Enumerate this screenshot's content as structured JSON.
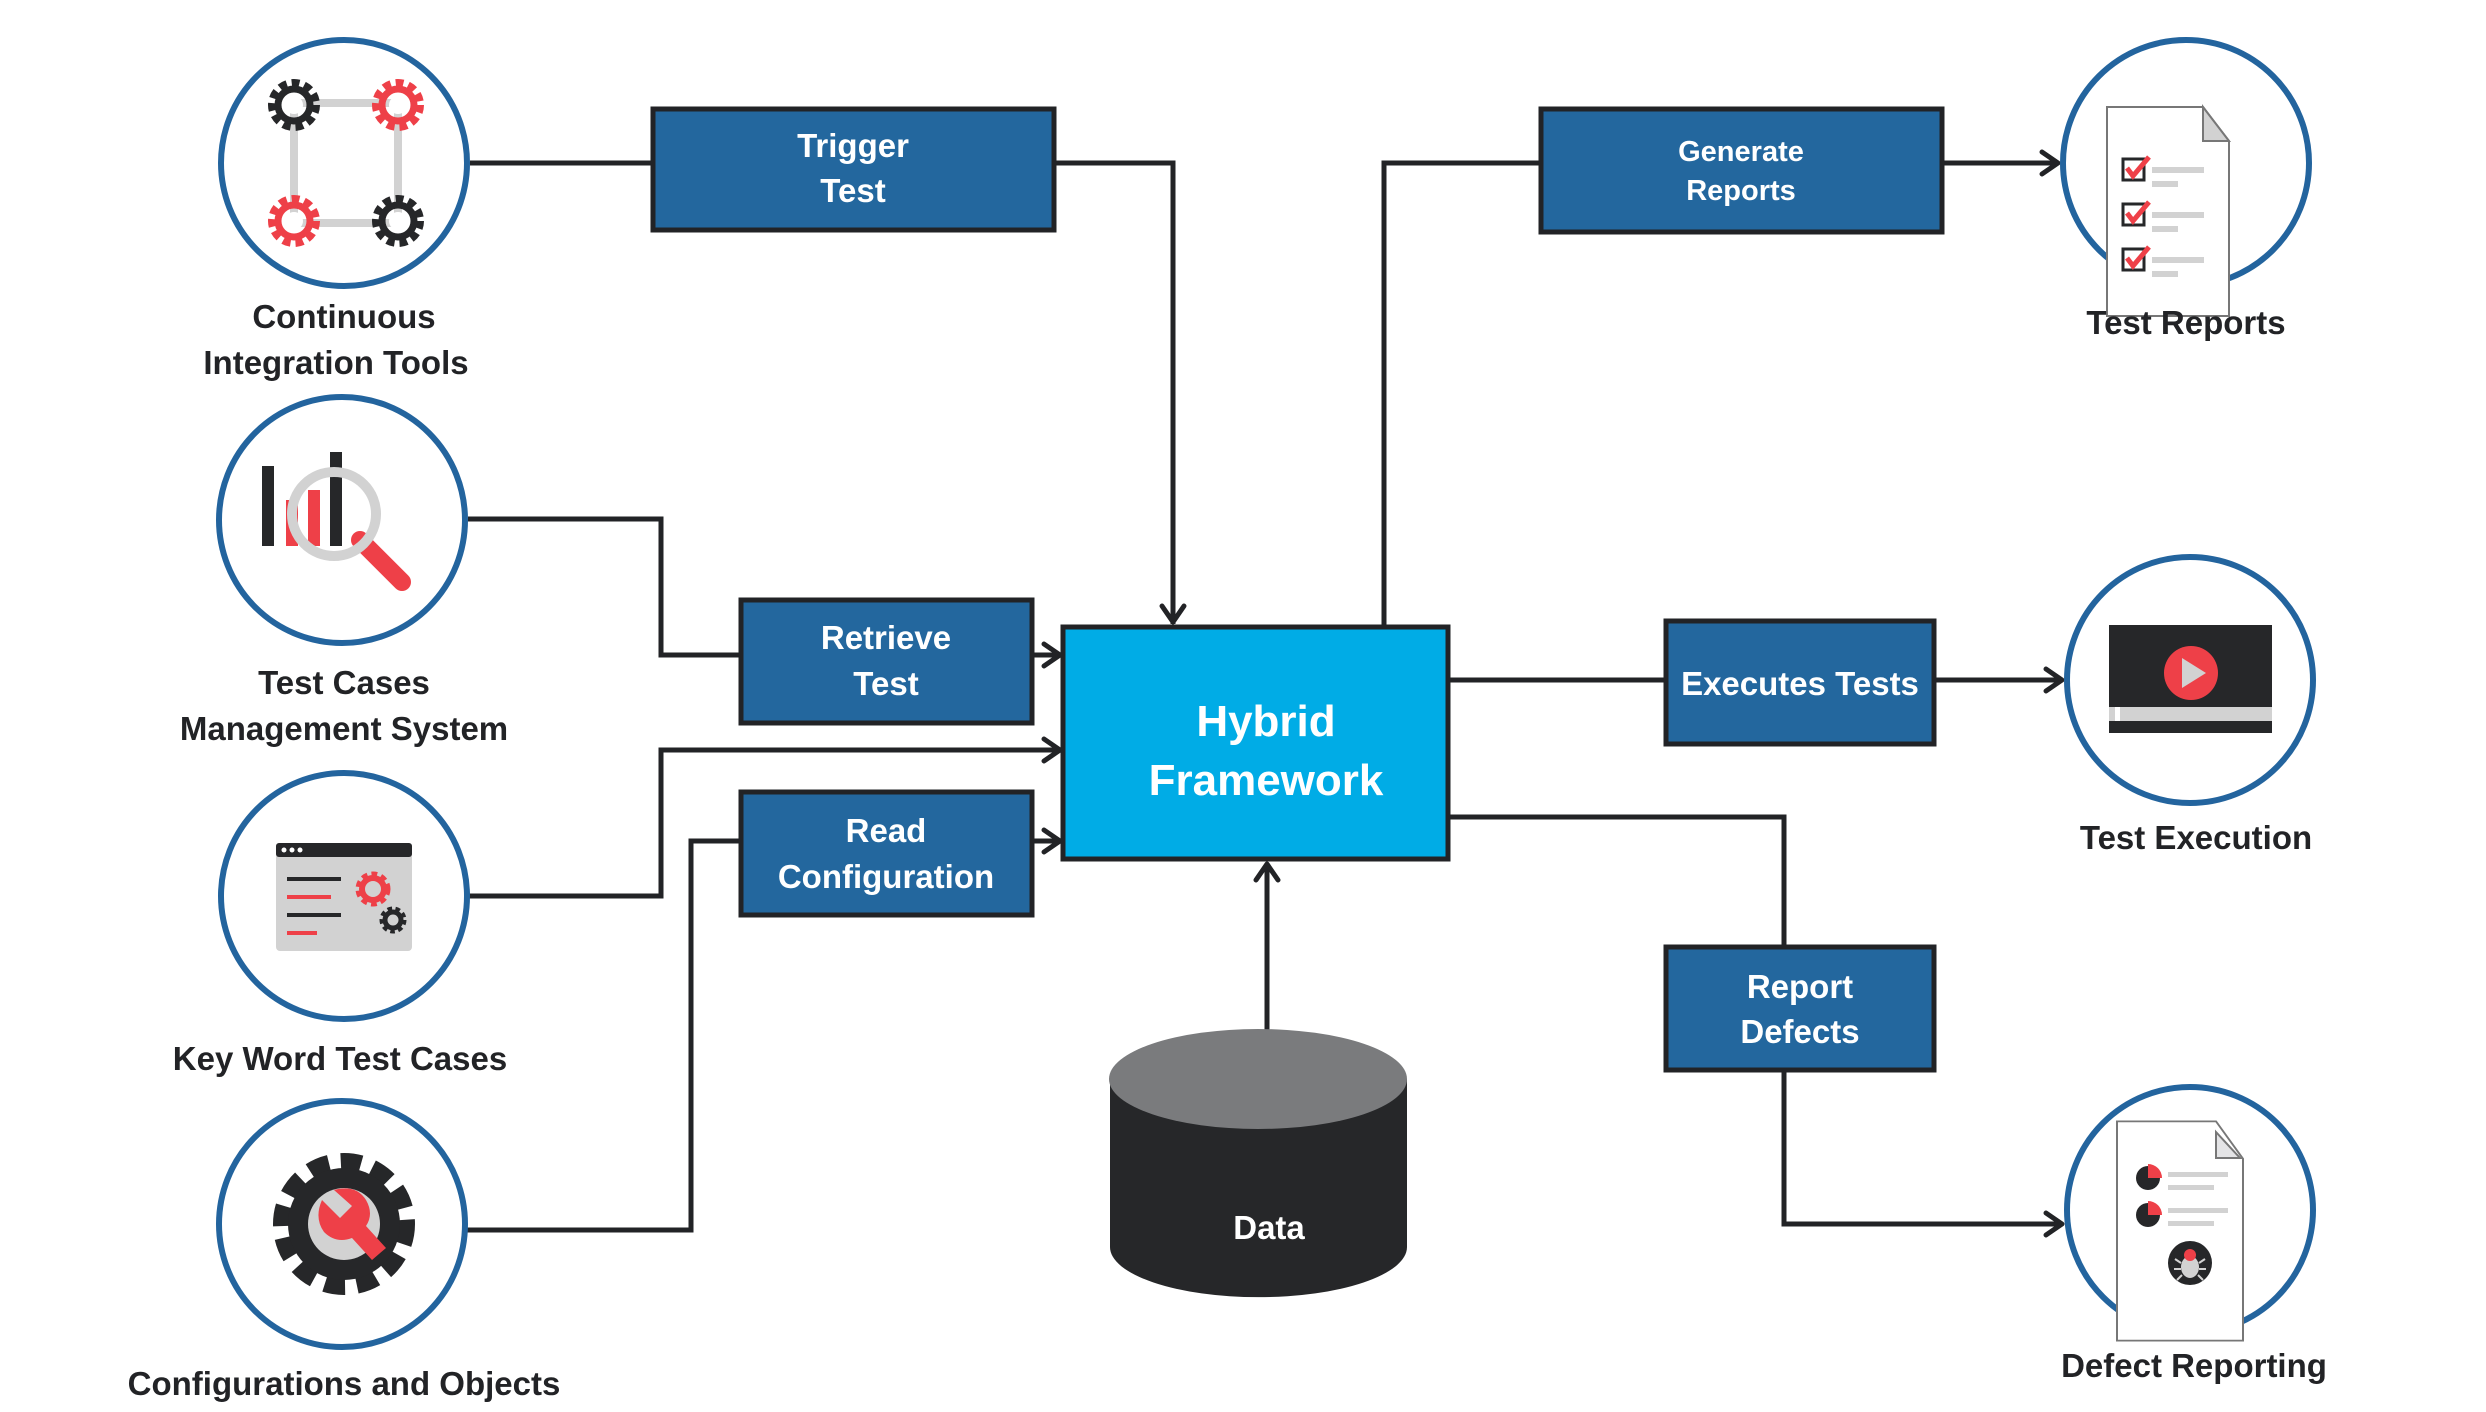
{
  "colors": {
    "process_box": "#23679e",
    "hub": "#00ace6",
    "ring": "#23649e",
    "line": "#222326",
    "accent_red": "#ee4048",
    "icon_gray": "#d2d2d2",
    "cylinder_top": "#7a7b7d",
    "cylinder_body": "#262729"
  },
  "hub": {
    "line1": "Hybrid",
    "line2": "Framework"
  },
  "data_store": {
    "label": "Data"
  },
  "inputs": [
    {
      "id": "ci",
      "icon": "gears-network-icon",
      "label_lines": [
        "Continuous",
        "Integration Tools"
      ]
    },
    {
      "id": "tcms",
      "icon": "chart-magnifier-icon",
      "label_lines": [
        "Test Cases",
        "Management System"
      ]
    },
    {
      "id": "kw",
      "icon": "browser-settings-icon",
      "label_lines": [
        "Key Word Test Cases"
      ]
    },
    {
      "id": "config",
      "icon": "gear-wrench-icon",
      "label_lines": [
        "Configurations and Objects"
      ]
    }
  ],
  "input_processes": [
    {
      "id": "trigger",
      "lines": [
        "Trigger",
        "Test"
      ]
    },
    {
      "id": "retrieve",
      "lines": [
        "Retrieve",
        "Test"
      ]
    },
    {
      "id": "read",
      "lines": [
        "Read",
        "Configuration"
      ]
    }
  ],
  "output_processes": [
    {
      "id": "generate",
      "lines": [
        "Generate",
        "Reports"
      ]
    },
    {
      "id": "executes",
      "lines": [
        "Executes Tests"
      ]
    },
    {
      "id": "report",
      "lines": [
        "Report",
        "Defects"
      ]
    }
  ],
  "outputs": [
    {
      "id": "reports",
      "icon": "checklist-document-icon",
      "label_lines": [
        "Test Reports"
      ]
    },
    {
      "id": "execution",
      "icon": "video-player-icon",
      "label_lines": [
        "Test Execution"
      ]
    },
    {
      "id": "defects",
      "icon": "bug-report-document-icon",
      "label_lines": [
        "Defect Reporting"
      ]
    }
  ]
}
